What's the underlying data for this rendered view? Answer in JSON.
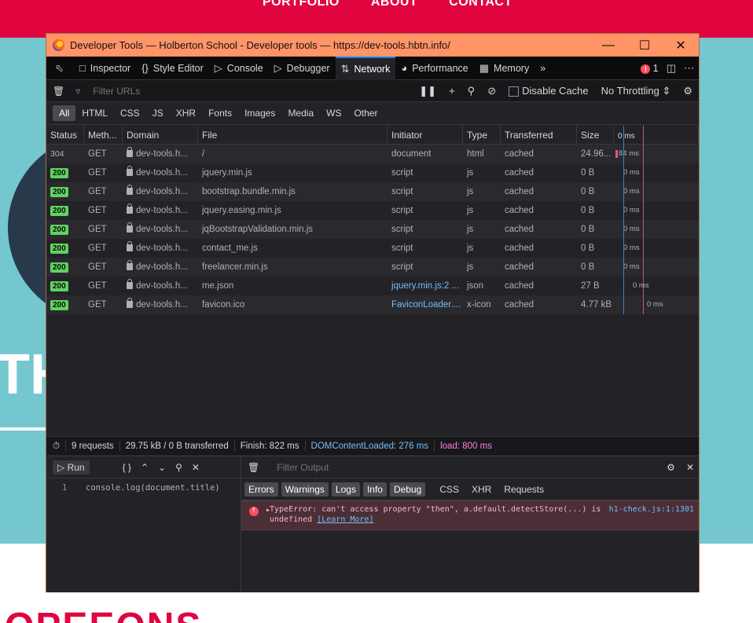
{
  "background": {
    "nav": [
      "PORTFOLIO",
      "ABOUT",
      "CONTACT"
    ],
    "hero_text": "TH",
    "section_text": "OPEEONS"
  },
  "window": {
    "title": "Developer Tools — Holberton School - Developer tools — https://dev-tools.hbtn.info/",
    "minimize_icon": "minimize-icon",
    "maximize_icon": "maximize-icon",
    "close_icon": "close-icon"
  },
  "toolbar": {
    "tabs": [
      {
        "label": "Inspector",
        "icon": "inspector-icon"
      },
      {
        "label": "Style Editor",
        "icon": "style-editor-icon"
      },
      {
        "label": "Console",
        "icon": "console-icon"
      },
      {
        "label": "Debugger",
        "icon": "debugger-icon"
      },
      {
        "label": "Network",
        "icon": "network-icon"
      },
      {
        "label": "Performance",
        "icon": "performance-icon"
      },
      {
        "label": "Memory",
        "icon": "memory-icon"
      }
    ],
    "active_tab": "Network",
    "error_count": "1"
  },
  "filter": {
    "placeholder": "Filter URLs",
    "disable_cache_label": "Disable Cache",
    "throttling": "No Throttling"
  },
  "types": [
    "All",
    "HTML",
    "CSS",
    "JS",
    "XHR",
    "Fonts",
    "Images",
    "Media",
    "WS",
    "Other"
  ],
  "columns": [
    "Status",
    "Meth...",
    "Domain",
    "File",
    "Initiator",
    "Type",
    "Transferred",
    "Size",
    "0 ms"
  ],
  "requests": [
    {
      "status": "304",
      "method": "GET",
      "domain": "dev-tools.h...",
      "file": "/",
      "initiator": "document",
      "type": "html",
      "transferred": "cached",
      "size": "24.96...",
      "time": "84 ms"
    },
    {
      "status": "200",
      "method": "GET",
      "domain": "dev-tools.h...",
      "file": "jquery.min.js",
      "initiator": "script",
      "type": "js",
      "transferred": "cached",
      "size": "0 B",
      "time": "0 ms"
    },
    {
      "status": "200",
      "method": "GET",
      "domain": "dev-tools.h...",
      "file": "bootstrap.bundle.min.js",
      "initiator": "script",
      "type": "js",
      "transferred": "cached",
      "size": "0 B",
      "time": "0 ms"
    },
    {
      "status": "200",
      "method": "GET",
      "domain": "dev-tools.h...",
      "file": "jquery.easing.min.js",
      "initiator": "script",
      "type": "js",
      "transferred": "cached",
      "size": "0 B",
      "time": "0 ms"
    },
    {
      "status": "200",
      "method": "GET",
      "domain": "dev-tools.h...",
      "file": "jqBootstrapValidation.min.js",
      "initiator": "script",
      "type": "js",
      "transferred": "cached",
      "size": "0 B",
      "time": "0 ms"
    },
    {
      "status": "200",
      "method": "GET",
      "domain": "dev-tools.h...",
      "file": "contact_me.js",
      "initiator": "script",
      "type": "js",
      "transferred": "cached",
      "size": "0 B",
      "time": "0 ms"
    },
    {
      "status": "200",
      "method": "GET",
      "domain": "dev-tools.h...",
      "file": "freelancer.min.js",
      "initiator": "script",
      "type": "js",
      "transferred": "cached",
      "size": "0 B",
      "time": "0 ms"
    },
    {
      "status": "200",
      "method": "GET",
      "domain": "dev-tools.h...",
      "file": "me.json",
      "initiator": "jquery.min.js:2 ...",
      "type": "json",
      "transferred": "cached",
      "size": "27 B",
      "time": "0 ms"
    },
    {
      "status": "200",
      "method": "GET",
      "domain": "dev-tools.h...",
      "file": "favicon.ico",
      "initiator": "FaviconLoader....",
      "type": "x-icon",
      "transferred": "cached",
      "size": "4.77 kB",
      "time": "0 ms"
    }
  ],
  "summary": {
    "requests": "9 requests",
    "transferred": "29.75 kB / 0 B transferred",
    "finish": "Finish: 822 ms",
    "dom_loaded": "DOMContentLoaded: 276 ms",
    "load": "load: 800 ms"
  },
  "editor": {
    "run_label": "Run",
    "braces_label": "{ }",
    "line_number": "1",
    "code": "console.log(document.title)"
  },
  "output": {
    "filter_placeholder": "Filter Output",
    "levels": [
      "Errors",
      "Warnings",
      "Logs",
      "Info",
      "Debug"
    ],
    "categories": [
      "CSS",
      "XHR",
      "Requests"
    ],
    "error_text": "TypeError: can't access property \"then\", a.default.detectStore(...) is undefined",
    "learn_more": "[Learn More]",
    "error_source": "h1-check.js:1:1301"
  },
  "colors": {
    "accent": "#0a84ff",
    "titlebar": "#ff9466",
    "status_ok": "#5ed35e",
    "error": "#ff4f5e"
  }
}
